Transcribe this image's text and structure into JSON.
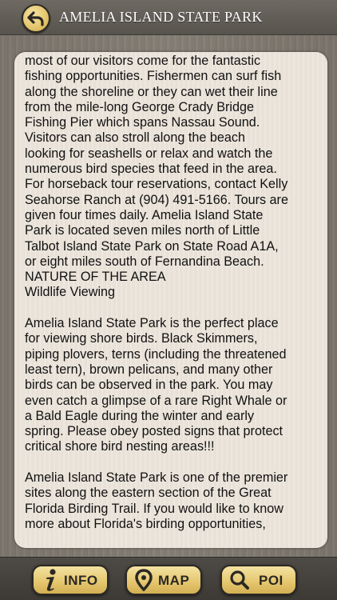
{
  "header": {
    "title": "AMELIA ISLAND STATE PARK",
    "back_icon": "back-arrow-icon"
  },
  "content": {
    "lines": [
      "most of our visitors come for the fantastic",
      "fishing opportunities. Fishermen can surf fish",
      "along the shoreline or they can wet their line",
      "from the mile-long George Crady Bridge",
      "Fishing Pier which spans Nassau Sound.",
      "Visitors can also stroll along the beach",
      "looking for seashells or relax and watch the",
      "numerous bird species that feed in the area.",
      "For horseback tour reservations, contact Kelly",
      "Seahorse Ranch at (904) 491-5166. Tours are",
      "given four times daily. Amelia Island State",
      "Park is located seven miles north of Little",
      "Talbot Island State Park on State Road A1A,",
      "or eight miles south of Fernandina Beach.",
      "NATURE OF THE AREA",
      "Wildlife Viewing",
      "",
      "Amelia Island State Park is the perfect place",
      "for viewing shore birds. Black Skimmers,",
      "piping plovers, terns (including the threatened",
      "least tern), brown pelicans, and many other",
      "birds can be observed in the park. You may",
      "even catch a glimpse of a rare Right Whale or",
      "a Bald Eagle during the winter and early",
      "spring. Please obey posted signs that protect",
      "critical shore bird nesting areas!!!",
      "",
      "Amelia Island State Park is one of the premier",
      "sites along the eastern section of the Great",
      "Florida Birding Trail. If you would like to know",
      "more about Florida's birding opportunities,"
    ]
  },
  "tabs": {
    "info": {
      "label": "INFO",
      "icon": "info-icon"
    },
    "map": {
      "label": "MAP",
      "icon": "map-pin-icon"
    },
    "poi": {
      "label": "POI",
      "icon": "search-icon"
    }
  },
  "colors": {
    "header_bg": "#615d57",
    "button_gold": "#e6c870",
    "panel_bg": "#ede6dc",
    "wood_bg": "#807a71",
    "text": "#111111"
  }
}
